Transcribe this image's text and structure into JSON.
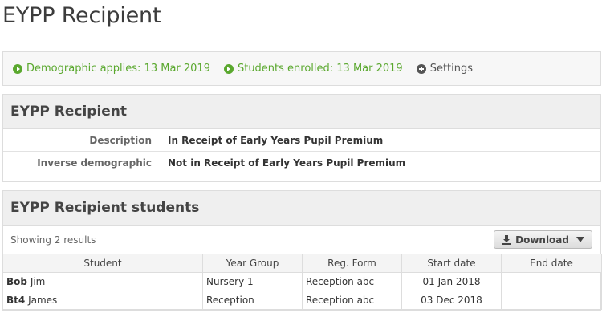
{
  "page": {
    "title": "EYPP Recipient"
  },
  "info_bar": {
    "demographic_applies": "Demographic applies: 13 Mar 2019",
    "students_enrolled": "Students enrolled: 13 Mar 2019",
    "settings": "Settings"
  },
  "details": {
    "header": "EYPP Recipient",
    "rows": [
      {
        "label": "Description",
        "value": "In Receipt of Early Years Pupil Premium"
      },
      {
        "label": "Inverse demographic",
        "value": "Not in Receipt of Early Years Pupil Premium"
      }
    ]
  },
  "students": {
    "header": "EYPP Recipient students",
    "showing": "Showing 2 results",
    "download_label": "Download",
    "columns": [
      "Student",
      "Year Group",
      "Reg. Form",
      "Start date",
      "End date"
    ],
    "rows": [
      {
        "surname": "Bob",
        "forename": "Jim",
        "year_group": "Nursery 1",
        "reg_form": "Reception abc",
        "start_date": "01 Jan 2018",
        "end_date": ""
      },
      {
        "surname": "Bt4",
        "forename": "James",
        "year_group": "Reception",
        "reg_form": "Reception abc",
        "start_date": "03 Dec 2018",
        "end_date": ""
      }
    ]
  },
  "colors": {
    "accent_green": "#5aa82e",
    "header_bg": "#efefef",
    "border": "#dddddd"
  }
}
